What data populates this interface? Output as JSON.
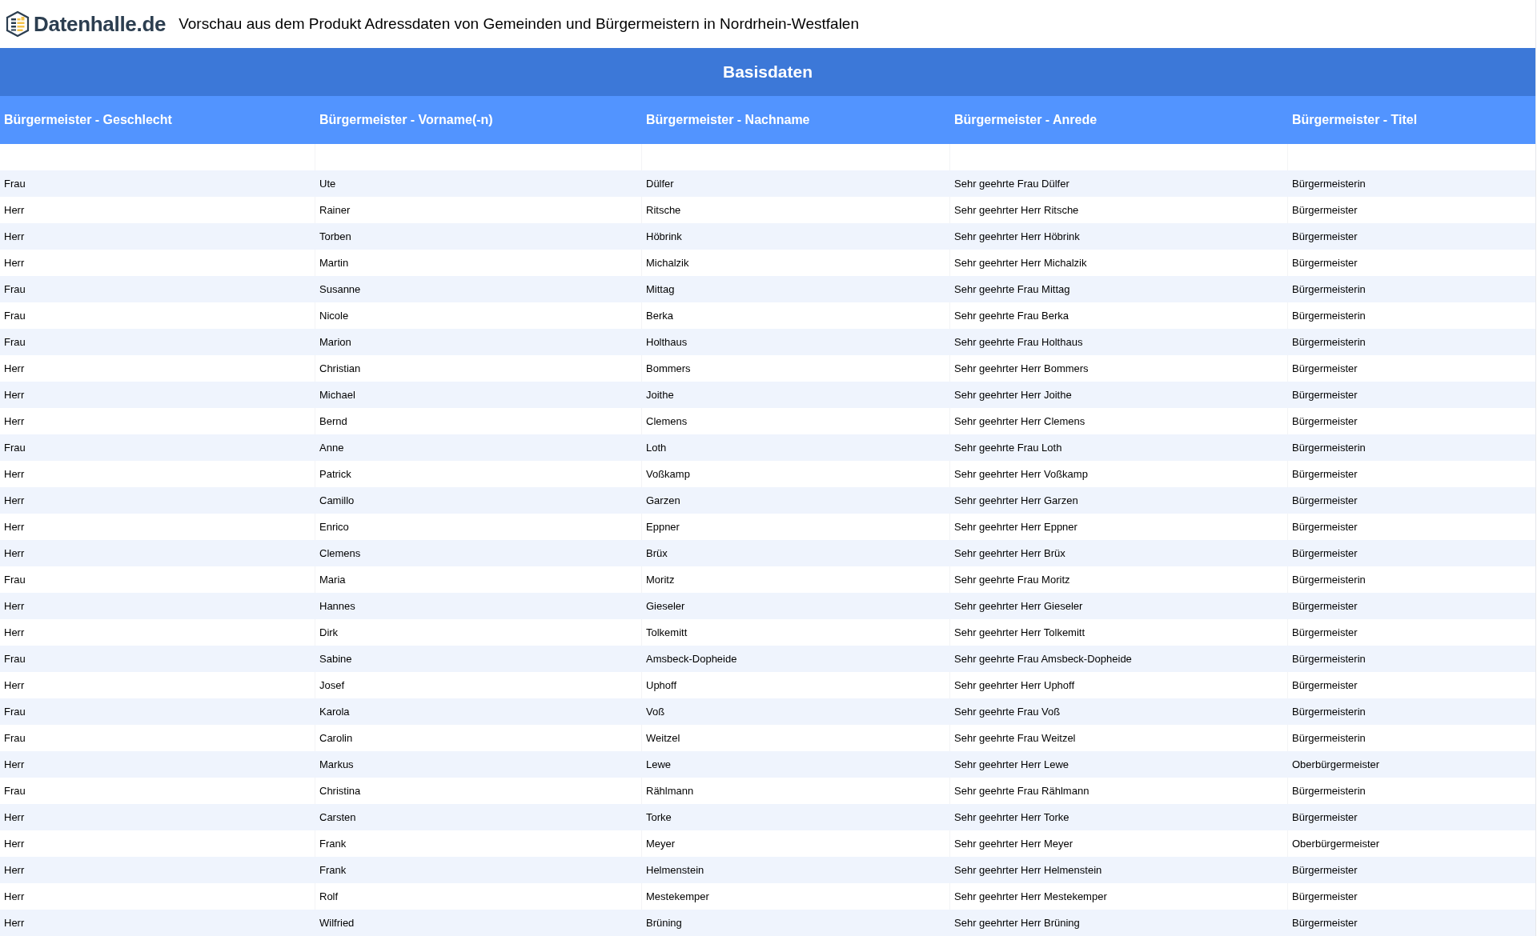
{
  "header": {
    "logo": "Datenhalle.de",
    "title": "Vorschau aus dem Produkt Adressdaten von Gemeinden und Bürgermeistern in Nordrhein-Westfalen"
  },
  "table": {
    "group_heading": "Basisdaten",
    "columns": [
      "Bürgermeister - Geschlecht",
      "Bürgermeister - Vorname(-n)",
      "Bürgermeister - Nachname",
      "Bürgermeister - Anrede",
      "Bürgermeister - Titel"
    ],
    "rows": [
      [
        "Frau",
        "Ute",
        "Dülfer",
        "Sehr geehrte Frau Dülfer",
        "Bürgermeisterin"
      ],
      [
        "Herr",
        "Rainer",
        "Ritsche",
        "Sehr geehrter Herr Ritsche",
        "Bürgermeister"
      ],
      [
        "Herr",
        "Torben",
        "Höbrink",
        "Sehr geehrter Herr Höbrink",
        "Bürgermeister"
      ],
      [
        "Herr",
        "Martin",
        "Michalzik",
        "Sehr geehrter Herr Michalzik",
        "Bürgermeister"
      ],
      [
        "Frau",
        "Susanne",
        "Mittag",
        "Sehr geehrte Frau Mittag",
        "Bürgermeisterin"
      ],
      [
        "Frau",
        "Nicole",
        "Berka",
        "Sehr geehrte Frau Berka",
        "Bürgermeisterin"
      ],
      [
        "Frau",
        "Marion",
        "Holthaus",
        "Sehr geehrte Frau Holthaus",
        "Bürgermeisterin"
      ],
      [
        "Herr",
        "Christian",
        "Bommers",
        "Sehr geehrter Herr Bommers",
        "Bürgermeister"
      ],
      [
        "Herr",
        "Michael",
        "Joithe",
        "Sehr geehrter Herr Joithe",
        "Bürgermeister"
      ],
      [
        "Herr",
        "Bernd",
        "Clemens",
        "Sehr geehrter Herr Clemens",
        "Bürgermeister"
      ],
      [
        "Frau",
        "Anne",
        "Loth",
        "Sehr geehrte Frau Loth",
        "Bürgermeisterin"
      ],
      [
        "Herr",
        "Patrick",
        "Voßkamp",
        "Sehr geehrter Herr Voßkamp",
        "Bürgermeister"
      ],
      [
        "Herr",
        "Camillo",
        "Garzen",
        "Sehr geehrter Herr Garzen",
        "Bürgermeister"
      ],
      [
        "Herr",
        "Enrico",
        "Eppner",
        "Sehr geehrter Herr Eppner",
        "Bürgermeister"
      ],
      [
        "Herr",
        "Clemens",
        "Brüx",
        "Sehr geehrter Herr Brüx",
        "Bürgermeister"
      ],
      [
        "Frau",
        "Maria",
        "Moritz",
        "Sehr geehrte Frau Moritz",
        "Bürgermeisterin"
      ],
      [
        "Herr",
        "Hannes",
        "Gieseler",
        "Sehr geehrter Herr Gieseler",
        "Bürgermeister"
      ],
      [
        "Herr",
        "Dirk",
        "Tolkemitt",
        "Sehr geehrter Herr Tolkemitt",
        "Bürgermeister"
      ],
      [
        "Frau",
        "Sabine",
        "Amsbeck-Dopheide",
        "Sehr geehrte Frau Amsbeck-Dopheide",
        "Bürgermeisterin"
      ],
      [
        "Herr",
        "Josef",
        "Uphoff",
        "Sehr geehrter Herr Uphoff",
        "Bürgermeister"
      ],
      [
        "Frau",
        "Karola",
        "Voß",
        "Sehr geehrte Frau Voß",
        "Bürgermeisterin"
      ],
      [
        "Frau",
        "Carolin",
        "Weitzel",
        "Sehr geehrte Frau Weitzel",
        "Bürgermeisterin"
      ],
      [
        "Herr",
        "Markus",
        "Lewe",
        "Sehr geehrter Herr Lewe",
        "Oberbürgermeister"
      ],
      [
        "Frau",
        "Christina",
        "Rählmann",
        "Sehr geehrte Frau Rählmann",
        "Bürgermeisterin"
      ],
      [
        "Herr",
        "Carsten",
        "Torke",
        "Sehr geehrter Herr Torke",
        "Bürgermeister"
      ],
      [
        "Herr",
        "Frank",
        "Meyer",
        "Sehr geehrter Herr Meyer",
        "Oberbürgermeister"
      ],
      [
        "Herr",
        "Frank",
        "Helmenstein",
        "Sehr geehrter Herr Helmenstein",
        "Bürgermeister"
      ],
      [
        "Herr",
        "Rolf",
        "Mestekemper",
        "Sehr geehrter Herr Mestekemper",
        "Bürgermeister"
      ],
      [
        "Herr",
        "Wilfried",
        "Brüning",
        "Sehr geehrter Herr Brüning",
        "Bürgermeister"
      ]
    ]
  }
}
